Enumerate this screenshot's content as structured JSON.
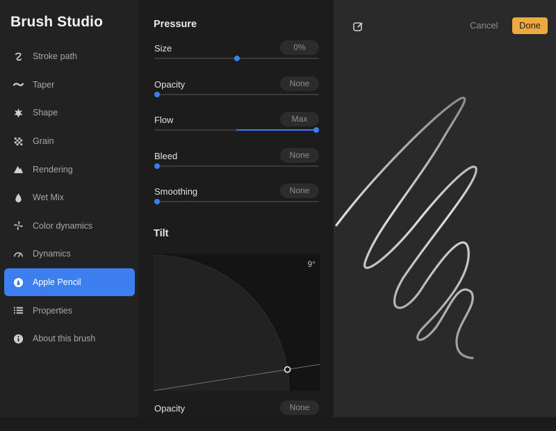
{
  "sidebar": {
    "title": "Brush Studio",
    "items": [
      {
        "label": "Stroke path",
        "icon": "stroke-path-icon"
      },
      {
        "label": "Taper",
        "icon": "taper-icon"
      },
      {
        "label": "Shape",
        "icon": "shape-icon"
      },
      {
        "label": "Grain",
        "icon": "grain-icon"
      },
      {
        "label": "Rendering",
        "icon": "rendering-icon"
      },
      {
        "label": "Wet Mix",
        "icon": "wet-mix-icon"
      },
      {
        "label": "Color dynamics",
        "icon": "color-dynamics-icon"
      },
      {
        "label": "Dynamics",
        "icon": "dynamics-icon"
      },
      {
        "label": "Apple Pencil",
        "icon": "apple-pencil-icon",
        "active": true
      },
      {
        "label": "Properties",
        "icon": "properties-icon"
      },
      {
        "label": "About this brush",
        "icon": "info-icon"
      }
    ]
  },
  "pressure": {
    "title": "Pressure",
    "settings": [
      {
        "label": "Size",
        "value": "0%",
        "level": 0.5
      },
      {
        "label": "Opacity",
        "value": "None",
        "level": 0
      },
      {
        "label": "Flow",
        "value": "Max",
        "level": 1.0
      },
      {
        "label": "Bleed",
        "value": "None",
        "level": 0
      },
      {
        "label": "Smoothing",
        "value": "None",
        "level": 0
      }
    ]
  },
  "tilt": {
    "title": "Tilt",
    "angle_label": "9°",
    "angle_degrees": 9,
    "settings": [
      {
        "label": "Opacity",
        "value": "None"
      }
    ]
  },
  "canvas": {
    "cancel_label": "Cancel",
    "done_label": "Done",
    "edit_icon": "edit-icon"
  },
  "colors": {
    "accent": "#3d7ff0",
    "done": "#f0a93f",
    "sidebar_bg": "#222222",
    "canvas_bg": "#2a2a2a"
  }
}
